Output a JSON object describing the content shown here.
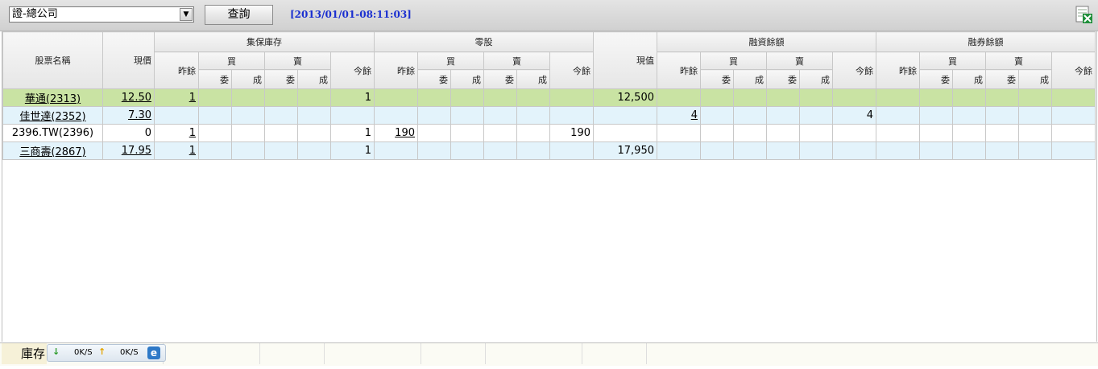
{
  "toolbar": {
    "branch_value": "證-總公司",
    "query_label": "查詢",
    "timestamp": "[2013/01/01-08:11:03]"
  },
  "headers": {
    "stock_name": "股票名稱",
    "price": "現價",
    "group_custody": "集保庫存",
    "odd_lot": "零股",
    "market_value": "現值",
    "margin_balance": "融資餘額",
    "short_balance": "融券餘額",
    "prev": "昨餘",
    "buy": "買",
    "sell": "賣",
    "order": "委",
    "filled": "成",
    "today": "今餘"
  },
  "rows": [
    {
      "name": "華通(2313)",
      "price": "12.50",
      "c_prev": "1",
      "c_today": "1",
      "o_prev": "",
      "o_today": "",
      "value": "12,500",
      "m_prev": "",
      "m_today": "",
      "s_prev": "",
      "s_today": ""
    },
    {
      "name": "佳世達(2352)",
      "price": "7.30",
      "c_prev": "",
      "c_today": "",
      "o_prev": "",
      "o_today": "",
      "value": "",
      "m_prev": "4",
      "m_today": "4",
      "s_prev": "",
      "s_today": ""
    },
    {
      "name": "2396.TW(2396)",
      "price": "0",
      "c_prev": "1",
      "c_today": "1",
      "o_prev": "190",
      "o_today": "190",
      "value": "",
      "m_prev": "",
      "m_today": "",
      "s_prev": "",
      "s_today": ""
    },
    {
      "name": "三商壽(2867)",
      "price": "17.95",
      "c_prev": "1",
      "c_today": "1",
      "o_prev": "",
      "o_today": "",
      "value": "17,950",
      "m_prev": "",
      "m_today": "",
      "s_prev": "",
      "s_today": ""
    }
  ],
  "status": {
    "label": "庫存",
    "down_speed": "0K/S",
    "up_speed": "0K/S"
  },
  "colors": {
    "selected_row": "#c9e3a3",
    "alt_row": "#e3f3fb",
    "timestamp": "#1a2fd0"
  }
}
